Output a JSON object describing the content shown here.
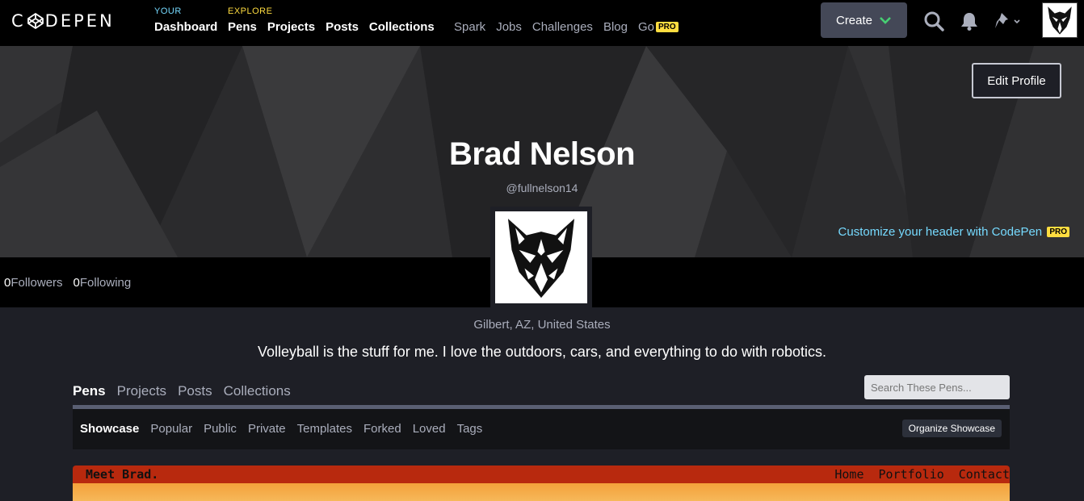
{
  "brand": {
    "logo_text": "CODEPEN"
  },
  "nav": {
    "your": {
      "kicker": "YOUR",
      "links": [
        "Dashboard"
      ]
    },
    "explore": {
      "kicker": "EXPLORE",
      "links": [
        "Pens",
        "Projects",
        "Posts",
        "Collections"
      ]
    },
    "secondary": [
      "Spark",
      "Jobs",
      "Challenges",
      "Blog"
    ],
    "go_label": "Go",
    "pro_badge": "PRO",
    "create_label": "Create"
  },
  "profile": {
    "edit_label": "Edit Profile",
    "name": "Brad Nelson",
    "handle": "@fullnelson14",
    "customize_text": "Customize your header with CodePen",
    "customize_badge": "PRO",
    "followers_count": "0",
    "followers_label": "Followers",
    "following_count": "0",
    "following_label": "Following",
    "location": "Gilbert, AZ, United States",
    "bio": "Volleyball is the stuff for me. I love the outdoors, cars, and everything to do with robotics."
  },
  "tabs": [
    "Pens",
    "Projects",
    "Posts",
    "Collections"
  ],
  "search": {
    "placeholder": "Search These Pens..."
  },
  "subnav": {
    "items": [
      "Showcase",
      "Popular",
      "Public",
      "Private",
      "Templates",
      "Forked",
      "Loved",
      "Tags"
    ],
    "organize_label": "Organize Showcase"
  },
  "showcase_preview": {
    "title": "Meet Brad.",
    "links": [
      "Home",
      "Portfolio",
      "Contact"
    ]
  },
  "colors": {
    "accent_blue": "#76daff",
    "accent_yellow": "#ffdd40",
    "accent_green": "#47cf73",
    "preview_red": "#b8290e"
  }
}
